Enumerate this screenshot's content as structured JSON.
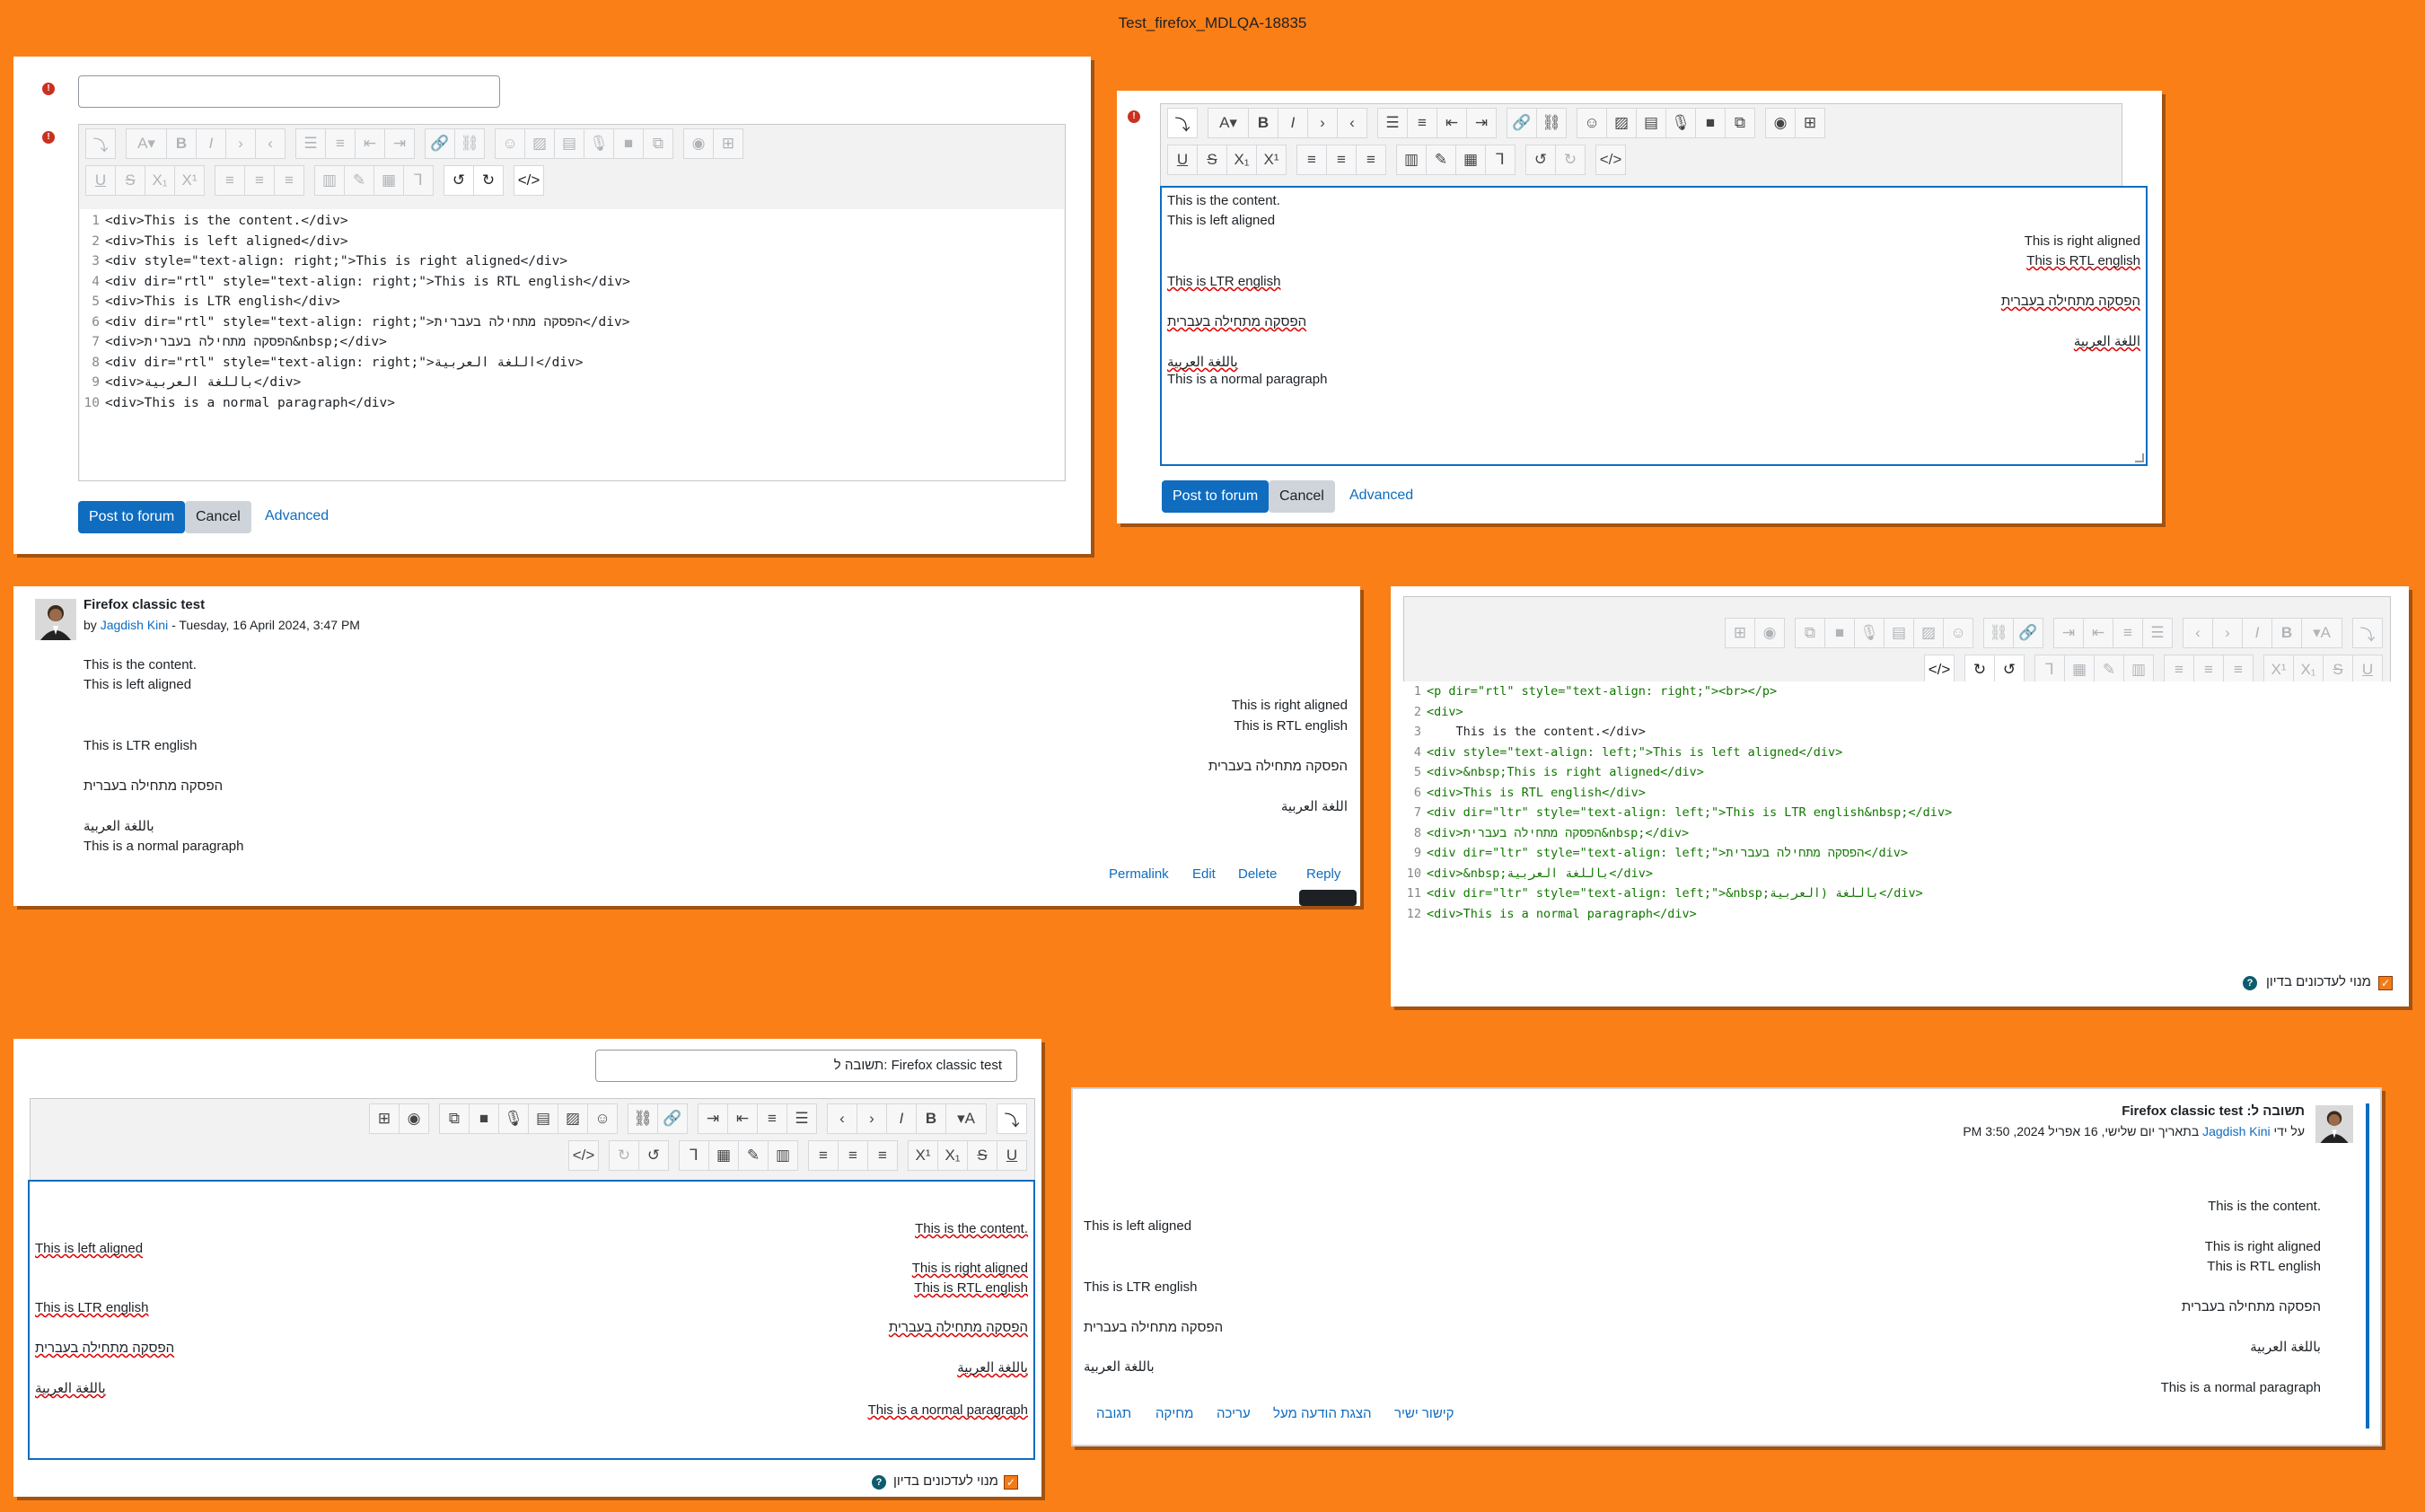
{
  "page_title": "Test_firefox_MDLQA-18835",
  "colors": {
    "background": "#fb7f17",
    "primary": "#0f6cbf",
    "error": "#ca3120",
    "focus_border": "#0f6cbf"
  },
  "panel1": {
    "subject_value": "",
    "code_lines": [
      "<div>This is the content.</div>",
      "<div>This is left aligned</div>",
      "<div style=\"text-align: right;\">This is right aligned</div>",
      "<div dir=\"rtl\" style=\"text-align: right;\">This is RTL english</div>",
      "<div>This is LTR english</div>",
      "<div dir=\"rtl\" style=\"text-align: right;\">הפסקה מתחילה בעברית</div>",
      "<div>הפסקה מתחילה בעברית&nbsp;</div>",
      "<div dir=\"rtl\" style=\"text-align: right;\">اللغة العربية</div>",
      "<div>باللغة العربية</div>",
      "<div>This is a normal paragraph</div>"
    ],
    "post_button": "Post to forum",
    "cancel_button": "Cancel",
    "advanced_link": "Advanced"
  },
  "panel2": {
    "lines": [
      {
        "text": "This is the content.",
        "align": "left"
      },
      {
        "text": "This is left aligned",
        "align": "left"
      },
      {
        "text": "This is right aligned",
        "align": "right"
      },
      {
        "text": "This is RTL english",
        "align": "right"
      },
      {
        "text": "This is LTR english",
        "align": "left"
      },
      {
        "text": "הפסקה מתחילה בעברית",
        "align": "right"
      },
      {
        "text": "הפסקה מתחילה בעברית",
        "align": "left"
      },
      {
        "text": "اللغة العربية",
        "align": "right"
      },
      {
        "text": "باللغة العربية",
        "align": "left"
      },
      {
        "text": "This is a normal paragraph",
        "align": "left"
      }
    ],
    "post_button": "Post to forum",
    "cancel_button": "Cancel",
    "advanced_link": "Advanced"
  },
  "panel3": {
    "title": "Firefox classic test",
    "byline_prefix": "by",
    "author": "Jagdish Kini",
    "date": "- Tuesday, 16 April 2024, 3:47 PM",
    "lines": [
      {
        "text": "This is the content.",
        "align": "left"
      },
      {
        "text": "This is left aligned",
        "align": "left"
      },
      {
        "text": "This is right aligned",
        "align": "right"
      },
      {
        "text": "This is RTL english",
        "align": "right"
      },
      {
        "text": "This is LTR english",
        "align": "left"
      },
      {
        "text": "הפסקה מתחילה בעברית",
        "align": "right"
      },
      {
        "text": "הפסקה מתחילה בעברית",
        "align": "left"
      },
      {
        "text": "اللغة العربية",
        "align": "right"
      },
      {
        "text": "باللغة العربية",
        "align": "left"
      },
      {
        "text": "This is a normal paragraph",
        "align": "left"
      }
    ],
    "actions": {
      "permalink": "Permalink",
      "edit": "Edit",
      "delete": "Delete",
      "reply": "Reply"
    }
  },
  "panel4": {
    "code_lines": [
      "<p dir=\"rtl\" style=\"text-align: right;\"><br></p>",
      "<div>",
      "    This is the content.</div>",
      "<div style=\"text-align: left;\">This is left aligned</div>",
      "<div>&nbsp;This is right aligned</div>",
      "<div>This is RTL english</div>",
      "<div dir=\"ltr\" style=\"text-align: left;\">This is LTR english&nbsp;</div>",
      "<div>הפסקה מתחילה בעברית&nbsp;</div>",
      "<div dir=\"ltr\" style=\"text-align: left;\">הפסקה מתחילה בעברית</div>",
      "<div>&nbsp;باللغة العربية</div>",
      "<div dir=\"ltr\" style=\"text-align: left;\">&nbsp;باللغة (العربية</div>",
      "<div>This is a normal paragraph</div>"
    ],
    "subscription_label": "מנוי לעדכונים בדיון"
  },
  "panel5": {
    "subject_value": "תשובה ל: Firefox classic test",
    "lines": [
      {
        "text": "This is the content.",
        "align": "right"
      },
      {
        "text": "This is left aligned",
        "align": "left"
      },
      {
        "text": "This is right aligned",
        "align": "right"
      },
      {
        "text": "This is RTL english",
        "align": "right"
      },
      {
        "text": "This is LTR english",
        "align": "left"
      },
      {
        "text": "הפסקה מתחילה בעברית",
        "align": "right"
      },
      {
        "text": "הפסקה מתחילה בעברית",
        "align": "left"
      },
      {
        "text": "باللغة العربية",
        "align": "right"
      },
      {
        "text": "باللغة العربية",
        "align": "left"
      },
      {
        "text": "This is a normal paragraph",
        "align": "right"
      }
    ],
    "subscription_label": "מנוי לעדכונים בדיון"
  },
  "panel6": {
    "title": "תשובה ל: Firefox classic test",
    "byline_prefix": "על ידי",
    "author": "Jagdish Kini",
    "date": "בתאריך יום שלישי, 16 אפריל 2024, 3:50 PM",
    "lines": [
      {
        "text": "This is the content.",
        "align": "right"
      },
      {
        "text": "This is left aligned",
        "align": "left"
      },
      {
        "text": "This is right aligned",
        "align": "right"
      },
      {
        "text": "This is RTL english",
        "align": "right"
      },
      {
        "text": "This is LTR english",
        "align": "left"
      },
      {
        "text": "הפסקה מתחילה בעברית",
        "align": "right"
      },
      {
        "text": "הפסקה מתחילה בעברית",
        "align": "left"
      },
      {
        "text": "باللغة العربية",
        "align": "right"
      },
      {
        "text": "باللغة العربية",
        "align": "left"
      },
      {
        "text": "This is a normal paragraph",
        "align": "right"
      }
    ],
    "actions": {
      "permalink": "קישור ישיר",
      "show_parent": "הצגת הודעה מעל",
      "edit": "עריכה",
      "delete": "מחיקה",
      "reply": "תגובה"
    }
  }
}
